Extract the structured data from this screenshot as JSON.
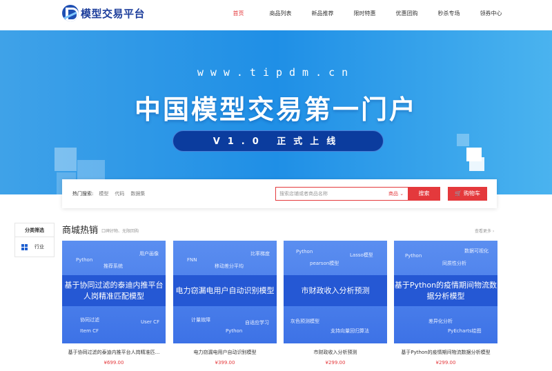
{
  "header": {
    "logo_text": "模型交易平台",
    "nav": [
      "首页",
      "商品列表",
      "新品推荐",
      "限时特惠",
      "优惠团购",
      "秒杀专场",
      "领券中心"
    ],
    "active_index": 0
  },
  "banner": {
    "url_text": "www.tipdm.cn",
    "title": "中国模型交易第一门户",
    "pill": "V1.0 正式上线"
  },
  "search": {
    "hot_label": "热门搜索:",
    "hot_items": [
      "模型",
      "代码",
      "数据集"
    ],
    "placeholder": "搜索店铺或者商品名称",
    "category": "商品",
    "search_button": "搜索",
    "cart_button": "购物车"
  },
  "sidebar": {
    "title": "分类筛选",
    "items": [
      {
        "label": "行业"
      }
    ]
  },
  "section": {
    "title": "商城热销",
    "subtitle": "口碑好物、无限回购",
    "more": "查看更多 ›"
  },
  "products": [
    {
      "band": "基于协同过滤的泰迪内推平台人岗精准匹配模型",
      "keywords": [
        "用户画像",
        "Python",
        "推荐系统",
        "协同过滤",
        "User CF",
        "Item CF"
      ],
      "name": "基于协同过滤的泰迪内推平台人岗精准匹...",
      "price": "¥699.00"
    },
    {
      "band": "电力窃漏电用户自动识别模型",
      "keywords": [
        "比率梯度",
        "FNN",
        "移动差分平均",
        "计量故障",
        "自适应学习",
        "Python"
      ],
      "name": "电力窃漏电用户自动识别模型",
      "price": "¥399.00"
    },
    {
      "band": "市财政收入分析预测",
      "keywords": [
        "Python",
        "Lasso模型",
        "pearson模型",
        "灰色预测模型",
        "支持向量回归算法"
      ],
      "name": "市财政收入分析预测",
      "price": "¥299.00"
    },
    {
      "band": "基于Python的疫情期间物流数据分析模型",
      "keywords": [
        "数据可视化",
        "Python",
        "同质性分析",
        "差异化分析",
        "PyEcharts绘图"
      ],
      "name": "基于Python的疫情期间物流数据分析模型",
      "price": "¥299.00"
    }
  ],
  "colors": {
    "accent": "#e4393c",
    "brand": "#1e3f9c",
    "banner": "#1f8fe6",
    "card": "#3d72e6"
  }
}
